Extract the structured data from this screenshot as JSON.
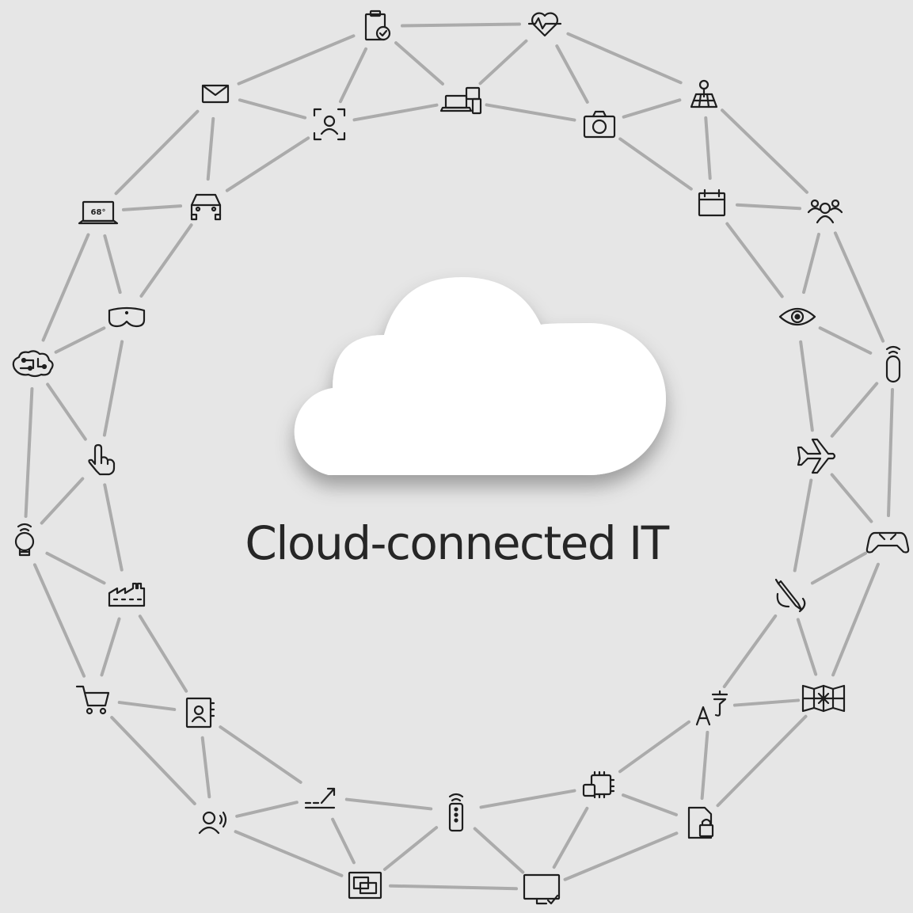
{
  "heading": "Cloud-connected IT",
  "colors": {
    "background": "#e6e6e6",
    "links": "#ababab",
    "icon": "#1e1e1e",
    "cloud": "#ffffff",
    "text": "#262626"
  },
  "center": {
    "type": "cloud",
    "icon": "cloud-icon"
  },
  "nodes": [
    {
      "id": "clipboard",
      "icon": "clipboard-check-icon"
    },
    {
      "id": "heart",
      "icon": "heart-rate-icon"
    },
    {
      "id": "map",
      "icon": "map-pin-icon"
    },
    {
      "id": "mail",
      "icon": "mail-icon"
    },
    {
      "id": "face-scan",
      "icon": "face-scan-icon"
    },
    {
      "id": "devices",
      "icon": "devices-icon"
    },
    {
      "id": "camera",
      "icon": "camera-icon"
    },
    {
      "id": "laptop",
      "icon": "laptop-temperature-icon",
      "text": "68°"
    },
    {
      "id": "car",
      "icon": "car-icon"
    },
    {
      "id": "calendar",
      "icon": "calendar-icon"
    },
    {
      "id": "people",
      "icon": "people-group-icon"
    },
    {
      "id": "headset",
      "icon": "mixed-reality-headset-icon"
    },
    {
      "id": "eye",
      "icon": "eye-icon"
    },
    {
      "id": "brain",
      "icon": "brain-circuit-icon"
    },
    {
      "id": "speaker",
      "icon": "smart-speaker-icon"
    },
    {
      "id": "hand",
      "icon": "touch-hand-icon"
    },
    {
      "id": "plane",
      "icon": "airplane-icon"
    },
    {
      "id": "bulb",
      "icon": "smart-bulb-icon"
    },
    {
      "id": "gamepad",
      "icon": "game-controller-icon"
    },
    {
      "id": "factory",
      "icon": "factory-icon"
    },
    {
      "id": "pen",
      "icon": "pen-icon"
    },
    {
      "id": "cart",
      "icon": "shopping-cart-icon"
    },
    {
      "id": "contact",
      "icon": "contact-book-icon"
    },
    {
      "id": "translate",
      "icon": "translate-icon"
    },
    {
      "id": "map-fold",
      "icon": "folded-map-icon"
    },
    {
      "id": "voice",
      "icon": "voice-person-icon"
    },
    {
      "id": "chart",
      "icon": "trend-arrow-icon"
    },
    {
      "id": "remote",
      "icon": "wireless-remote-icon"
    },
    {
      "id": "chip",
      "icon": "processor-chip-icon"
    },
    {
      "id": "file-lock",
      "icon": "locked-file-icon"
    },
    {
      "id": "dashboard",
      "icon": "dashboard-icon"
    },
    {
      "id": "monitor",
      "icon": "monitor-check-icon"
    }
  ],
  "links": [
    [
      "clipboard",
      "heart"
    ],
    [
      "heart",
      "map"
    ],
    [
      "map",
      "people"
    ],
    [
      "people",
      "speaker"
    ],
    [
      "speaker",
      "gamepad"
    ],
    [
      "gamepad",
      "map-fold"
    ],
    [
      "map-fold",
      "file-lock"
    ],
    [
      "file-lock",
      "monitor"
    ],
    [
      "monitor",
      "dashboard"
    ],
    [
      "dashboard",
      "voice"
    ],
    [
      "voice",
      "cart"
    ],
    [
      "cart",
      "bulb"
    ],
    [
      "bulb",
      "brain"
    ],
    [
      "brain",
      "laptop"
    ],
    [
      "laptop",
      "mail"
    ],
    [
      "mail",
      "clipboard"
    ],
    [
      "face-scan",
      "devices"
    ],
    [
      "devices",
      "camera"
    ],
    [
      "camera",
      "calendar"
    ],
    [
      "calendar",
      "eye"
    ],
    [
      "eye",
      "plane"
    ],
    [
      "plane",
      "pen"
    ],
    [
      "pen",
      "translate"
    ],
    [
      "translate",
      "chip"
    ],
    [
      "chip",
      "remote"
    ],
    [
      "remote",
      "chart"
    ],
    [
      "chart",
      "contact"
    ],
    [
      "contact",
      "factory"
    ],
    [
      "factory",
      "hand"
    ],
    [
      "hand",
      "headset"
    ],
    [
      "headset",
      "car"
    ],
    [
      "car",
      "face-scan"
    ],
    [
      "clipboard",
      "face-scan"
    ],
    [
      "clipboard",
      "devices"
    ],
    [
      "heart",
      "devices"
    ],
    [
      "heart",
      "camera"
    ],
    [
      "map",
      "camera"
    ],
    [
      "map",
      "calendar"
    ],
    [
      "people",
      "calendar"
    ],
    [
      "people",
      "eye"
    ],
    [
      "speaker",
      "eye"
    ],
    [
      "speaker",
      "plane"
    ],
    [
      "gamepad",
      "plane"
    ],
    [
      "gamepad",
      "pen"
    ],
    [
      "map-fold",
      "pen"
    ],
    [
      "map-fold",
      "translate"
    ],
    [
      "file-lock",
      "translate"
    ],
    [
      "file-lock",
      "chip"
    ],
    [
      "monitor",
      "chip"
    ],
    [
      "monitor",
      "remote"
    ],
    [
      "dashboard",
      "remote"
    ],
    [
      "dashboard",
      "chart"
    ],
    [
      "voice",
      "chart"
    ],
    [
      "voice",
      "contact"
    ],
    [
      "cart",
      "contact"
    ],
    [
      "cart",
      "factory"
    ],
    [
      "bulb",
      "factory"
    ],
    [
      "bulb",
      "hand"
    ],
    [
      "brain",
      "hand"
    ],
    [
      "brain",
      "headset"
    ],
    [
      "laptop",
      "headset"
    ],
    [
      "laptop",
      "car"
    ],
    [
      "mail",
      "car"
    ],
    [
      "mail",
      "face-scan"
    ]
  ]
}
